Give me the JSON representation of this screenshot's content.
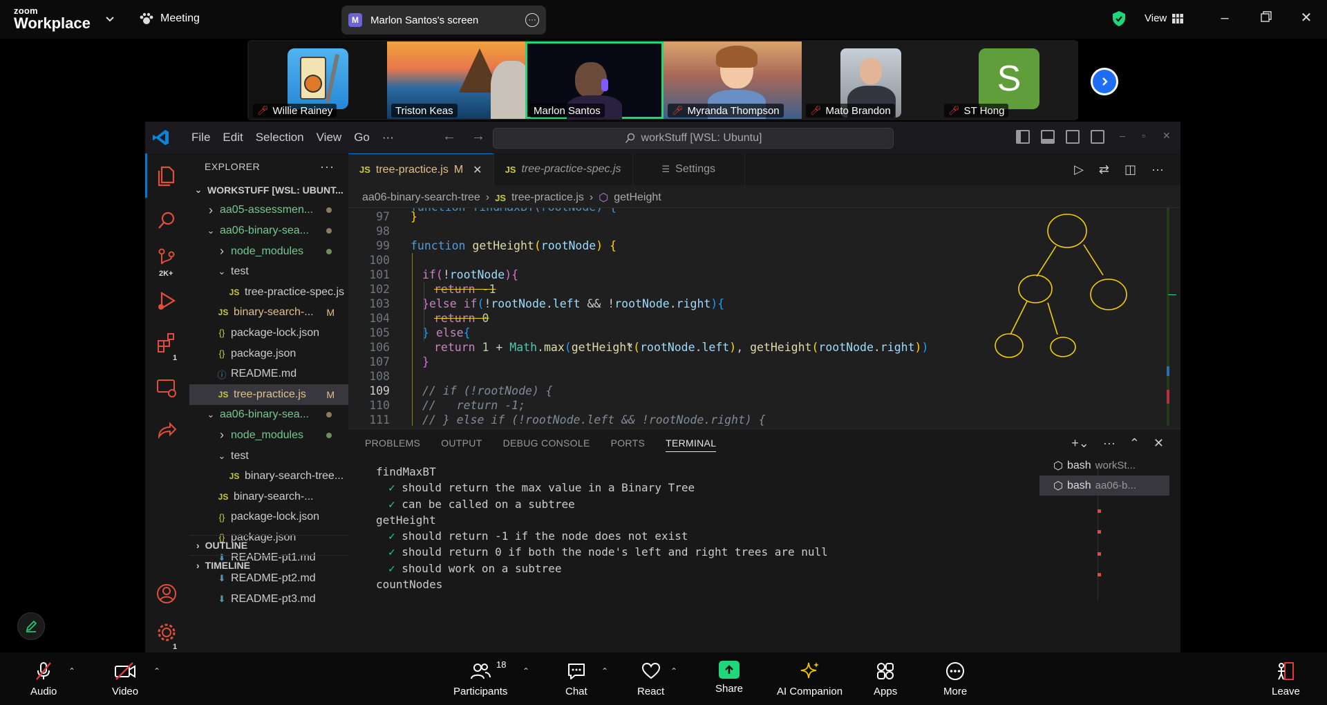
{
  "zoom": {
    "brand_top": "zoom",
    "brand_bottom": "Workplace",
    "meeting_label": "Meeting",
    "share_pill": {
      "badge": "M",
      "label": "Marlon Santos's screen"
    },
    "view_label": "View"
  },
  "participants": [
    {
      "name": "Willie Rainey",
      "muted": true
    },
    {
      "name": "Triston Keas",
      "muted": false
    },
    {
      "name": "Marlon Santos",
      "muted": false,
      "active_speaker": true
    },
    {
      "name": "Myranda Thompson",
      "muted": true
    },
    {
      "name": "Mato Brandon",
      "muted": true
    },
    {
      "name": "ST Hong",
      "muted": true,
      "avatar_letter": "S"
    }
  ],
  "vscode": {
    "menu": [
      "File",
      "Edit",
      "Selection",
      "View",
      "Go",
      "···"
    ],
    "command_center": "workStuff [WSL: Ubuntu]",
    "activity_badges": {
      "source_control": "2K+",
      "extensions": "1",
      "settings": "1"
    },
    "explorer": {
      "title": "EXPLORER",
      "root": "WORKSTUFF [WSL: UBUNT...",
      "items": [
        {
          "label": "aa05-assessmen...",
          "icon": ">",
          "indent": 1
        },
        {
          "label": "aa06-binary-sea...",
          "icon": "v",
          "indent": 1
        },
        {
          "label": "node_modules",
          "icon": ">",
          "indent": 2
        },
        {
          "label": "test",
          "icon": "v",
          "indent": 2
        },
        {
          "label": "tree-practice-spec.js",
          "icon": "JS",
          "indent": 3
        },
        {
          "label": "binary-search-...",
          "icon": "JS",
          "indent": 2,
          "status": "M"
        },
        {
          "label": "package-lock.json",
          "icon": "{}",
          "indent": 2
        },
        {
          "label": "package.json",
          "icon": "{}",
          "indent": 2
        },
        {
          "label": "README.md",
          "icon": "i",
          "indent": 2
        },
        {
          "label": "tree-practice.js",
          "icon": "JS",
          "indent": 2,
          "status": "M"
        },
        {
          "label": "aa06-binary-sea...",
          "icon": "v",
          "indent": 1
        },
        {
          "label": "node_modules",
          "icon": ">",
          "indent": 2
        },
        {
          "label": "test",
          "icon": "v",
          "indent": 2
        },
        {
          "label": "binary-search-tree...",
          "icon": "JS",
          "indent": 3
        },
        {
          "label": "binary-search-...",
          "icon": "JS",
          "indent": 2
        },
        {
          "label": "package-lock.json",
          "icon": "{}",
          "indent": 2
        },
        {
          "label": "package.json",
          "icon": "{}",
          "indent": 2
        },
        {
          "label": "README-pt1.md",
          "icon": "md",
          "indent": 2
        },
        {
          "label": "README-pt2.md",
          "icon": "md",
          "indent": 2
        },
        {
          "label": "README-pt3.md",
          "icon": "md",
          "indent": 2
        }
      ],
      "outline": "OUTLINE",
      "timeline": "TIMELINE"
    },
    "tabs": [
      {
        "label": "tree-practice.js",
        "badge": "M",
        "active": true
      },
      {
        "label": "tree-practice-spec.js",
        "active": false
      },
      {
        "label": "Settings",
        "active": false
      }
    ],
    "breadcrumb": [
      "aa06-binary-search-tree",
      "tree-practice.js",
      "getHeight"
    ],
    "line_numbers": [
      "97",
      "98",
      "99",
      "100",
      "101",
      "102",
      "103",
      "104",
      "105",
      "106",
      "107",
      "108",
      "109",
      "110",
      "111"
    ],
    "code_top_partial": "function findMaxBT(rootNode) {",
    "panel_tabs": [
      "PROBLEMS",
      "OUTPUT",
      "DEBUG CONSOLE",
      "PORTS",
      "TERMINAL"
    ],
    "terminal_lines": [
      {
        "text": "findMaxBT",
        "check": false,
        "indent": 0
      },
      {
        "text": "should return the max value in a Binary Tree",
        "check": true,
        "indent": 1
      },
      {
        "text": "can be called on a subtree",
        "check": true,
        "indent": 1
      },
      {
        "text": "getHeight",
        "check": false,
        "indent": 0
      },
      {
        "text": "should return -1 if the node does not exist",
        "check": true,
        "indent": 1
      },
      {
        "text": "should return 0 if both the node's left and right trees are null",
        "check": true,
        "indent": 1
      },
      {
        "text": "should work on a subtree",
        "check": true,
        "indent": 1
      },
      {
        "text": "countNodes",
        "check": false,
        "indent": 0
      }
    ],
    "terminal_instances": [
      {
        "name": "bash",
        "sub": "workSt..."
      },
      {
        "name": "bash",
        "sub": "aa06-b..."
      }
    ]
  },
  "toolbar": {
    "audio": "Audio",
    "video": "Video",
    "participants": "Participants",
    "participants_count": "18",
    "chat": "Chat",
    "react": "React",
    "share": "Share",
    "ai": "AI Companion",
    "apps": "Apps",
    "more": "More",
    "leave": "Leave"
  },
  "colors": {
    "zoom_green": "#1fd67a",
    "zoom_blue": "#1e6ef5",
    "annotation_yellow": "#f5d000",
    "vscode_blue": "#0078d4"
  }
}
